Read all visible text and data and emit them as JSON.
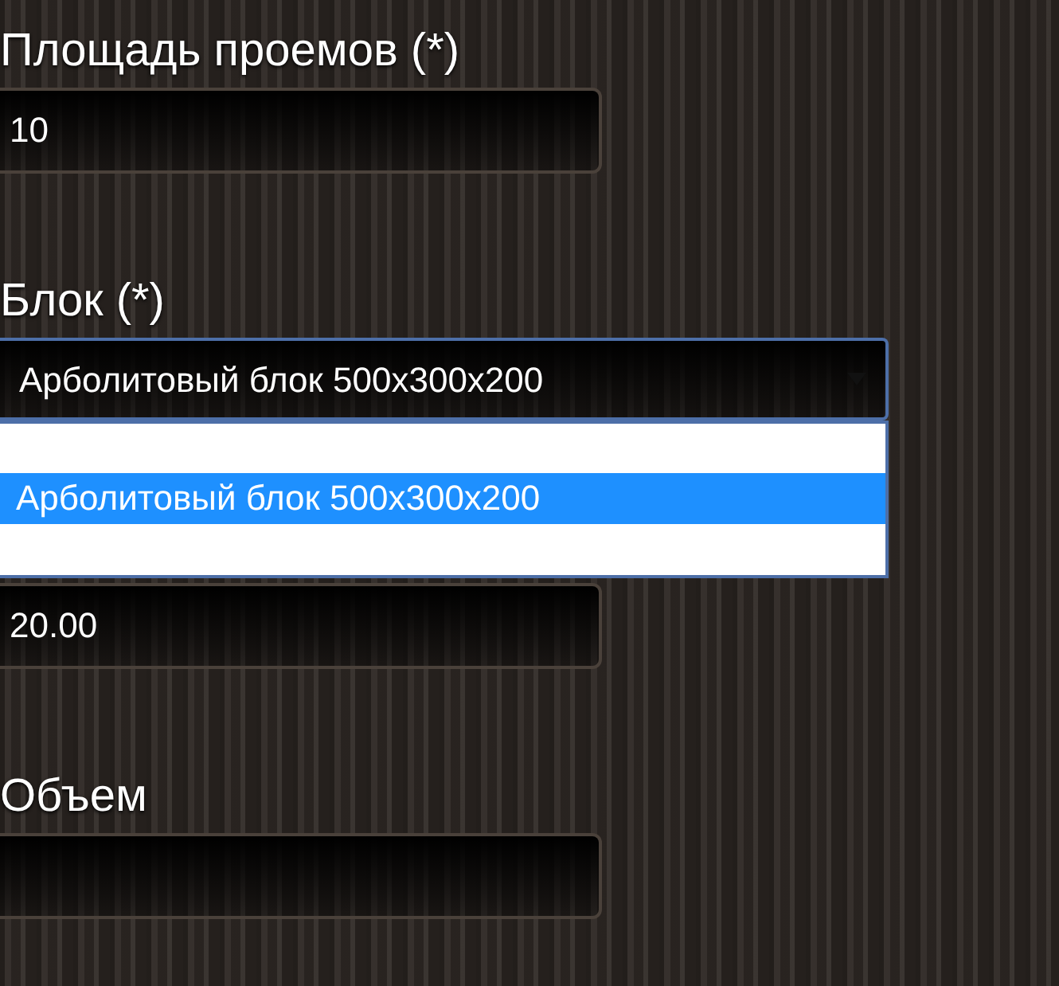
{
  "fields": [
    {
      "kind": "input",
      "label": "Площадь проемов (*)",
      "value": "10"
    },
    {
      "kind": "select",
      "label": "Блок (*)",
      "value": "Арболитовый блок 500x300x200",
      "expanded": true,
      "options": [
        {
          "label": "Арболитовый блок 500x300x200",
          "selected": true
        }
      ]
    },
    {
      "kind": "input",
      "value": "20.00"
    },
    {
      "kind": "input",
      "label": "Объем"
    }
  ]
}
